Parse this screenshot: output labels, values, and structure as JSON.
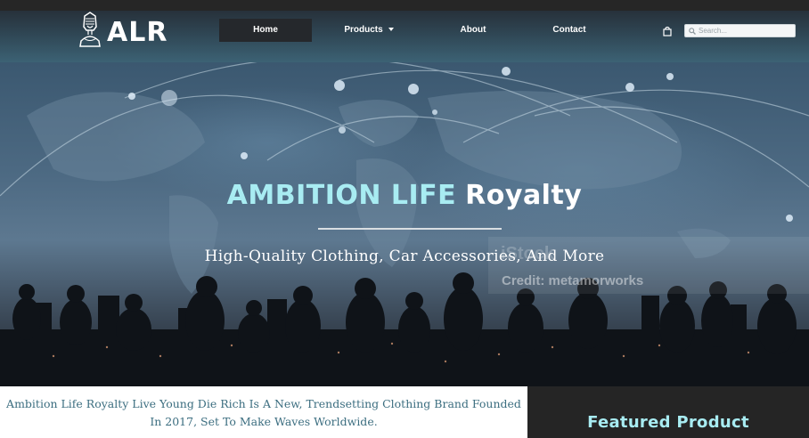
{
  "brand": {
    "logo_text": "ALR",
    "logo_icon": "pharaoh-bust-icon"
  },
  "nav": {
    "items": [
      {
        "label": "Home",
        "active": true
      },
      {
        "label": "Products",
        "has_dropdown": true
      },
      {
        "label": "About"
      },
      {
        "label": "Contact"
      }
    ]
  },
  "header": {
    "cart_icon": "shopping-bag-icon",
    "search_icon": "search-icon",
    "search_placeholder": "Search..."
  },
  "hero": {
    "title_part1": "AMBITION LIFE",
    "title_part2": "Royalty",
    "subtitle": "High-Quality Clothing, Car Accessories, And More",
    "watermark_brand": "iStock",
    "watermark_credit": "Credit: metamorworks"
  },
  "intro": {
    "text": "Ambition Life Royalty Live Young Die Rich Is A New, Trendsetting Clothing Brand Founded In 2017, Set To Make Waves Worldwide."
  },
  "featured": {
    "heading": "Featured Product"
  },
  "colors": {
    "accent": "#a8ecf2",
    "intro_text": "#3c6e80",
    "dark": "#252525"
  }
}
